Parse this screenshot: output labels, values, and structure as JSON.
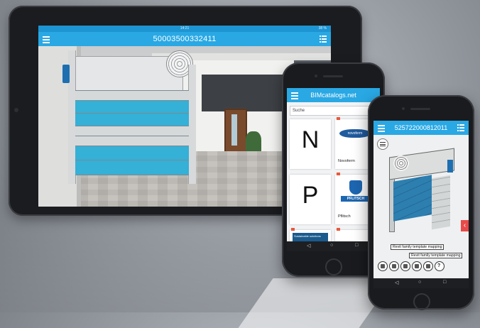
{
  "tablet": {
    "status_time": "14:21",
    "status_battery": "38 %",
    "title": "50003500332411"
  },
  "phone1": {
    "title": "BIMcatalogs.net",
    "search_placeholder": "Suche",
    "tiles": [
      {
        "letter": "N"
      },
      {
        "caption": "Novoferm",
        "logo_text": "novoferm"
      },
      {
        "letter": "P"
      },
      {
        "caption": "Pflitsch",
        "logo_text": "PFLITSCH"
      },
      {
        "logo_text": "Sustainable solutions"
      }
    ],
    "nav": {
      "back": "◁",
      "home": "○",
      "recent": "□"
    }
  },
  "phone2": {
    "title": "525722000812011",
    "label_1": "Revit family template mapping",
    "label_2": "Revit family template mapping",
    "chevron": "‹",
    "help": "?",
    "nav": {
      "back": "◁",
      "home": "○",
      "recent": "□"
    }
  },
  "colors": {
    "app_bar": "#29a8e4",
    "door_panel": "#35b0d6",
    "accent_red": "#e84a4a"
  }
}
